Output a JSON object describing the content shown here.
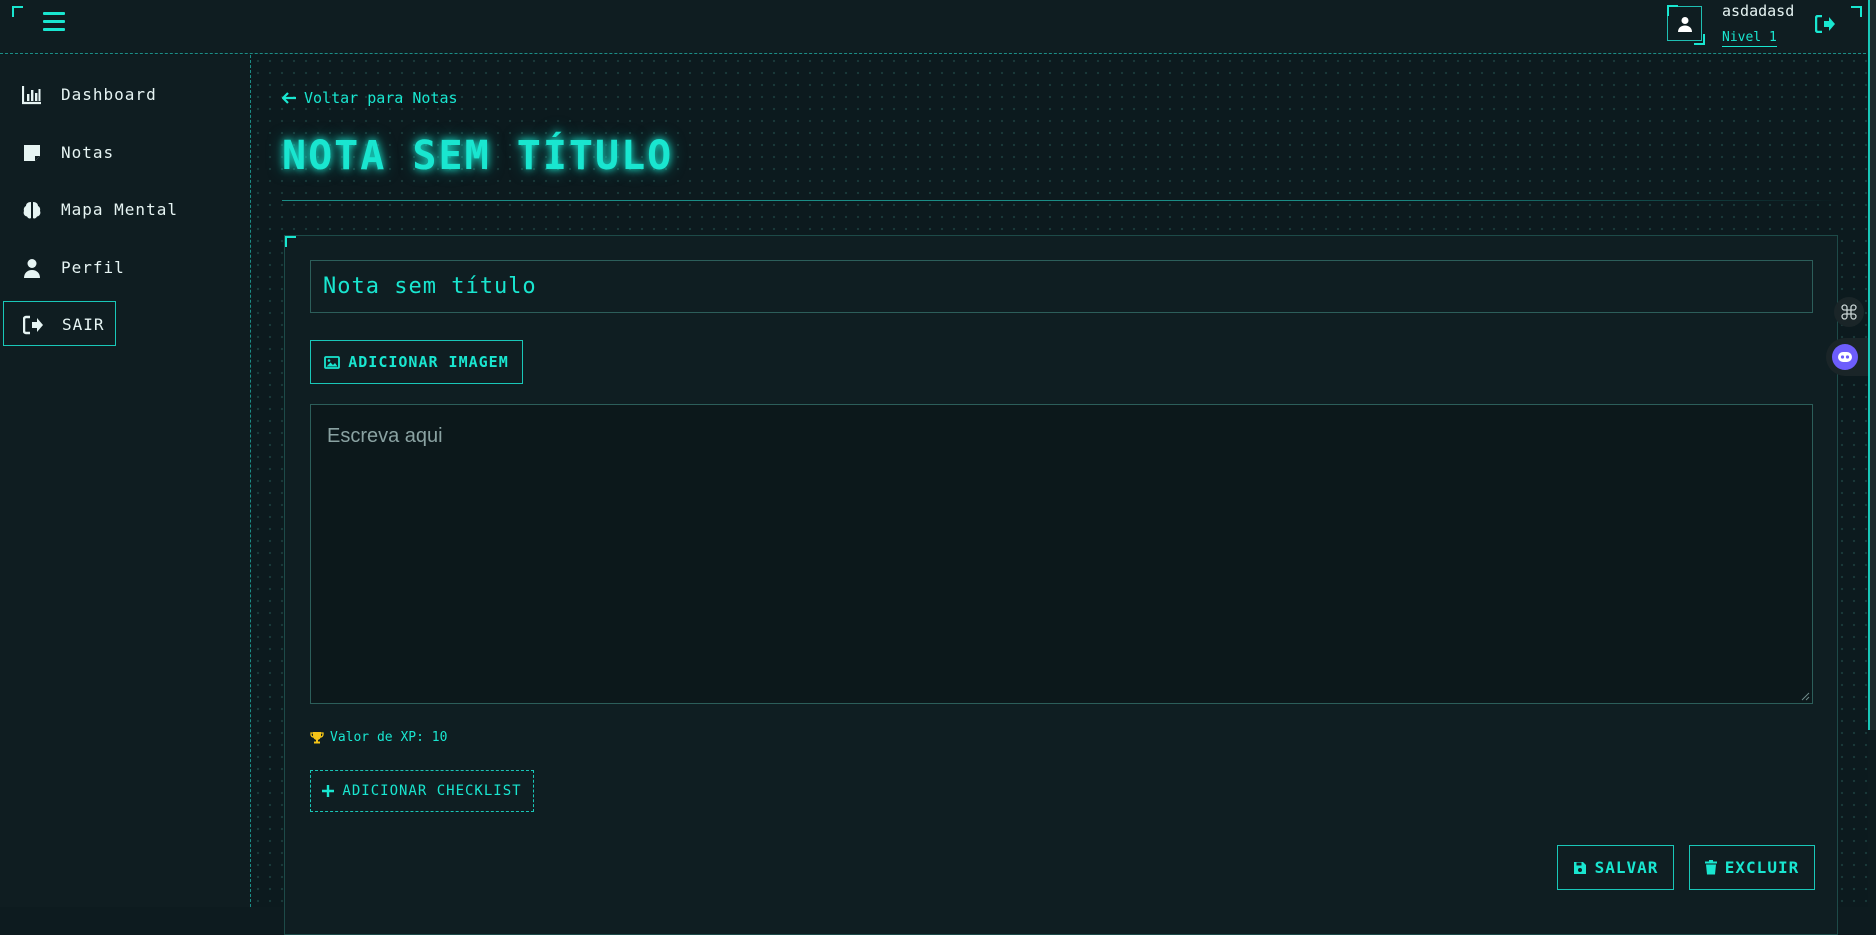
{
  "header": {
    "username": "asdadasd",
    "level": "Nivel 1"
  },
  "sidebar": {
    "items": [
      {
        "label": "Dashboard",
        "icon": "chart-bar-icon"
      },
      {
        "label": "Notas",
        "icon": "note-icon"
      },
      {
        "label": "Mapa Mental",
        "icon": "brain-icon"
      },
      {
        "label": "Perfil",
        "icon": "user-icon"
      },
      {
        "label": "SAIR",
        "icon": "logout-icon"
      }
    ]
  },
  "main": {
    "back_link": "Voltar para Notas",
    "page_title": "NOTA SEM TÍTULO",
    "editor": {
      "title_value": "Nota sem título",
      "add_image_label": "ADICIONAR IMAGEM",
      "content_placeholder": "Escreva aqui",
      "xp_text": "Valor de XP: 10",
      "add_checklist_label": "ADICIONAR CHECKLIST",
      "save_label": "SALVAR",
      "delete_label": "EXCLUIR"
    }
  },
  "colors": {
    "accent": "#19e6d0",
    "background": "#0d1b1f",
    "trophy": "#f5c518",
    "bot": "#6d5dfc"
  }
}
